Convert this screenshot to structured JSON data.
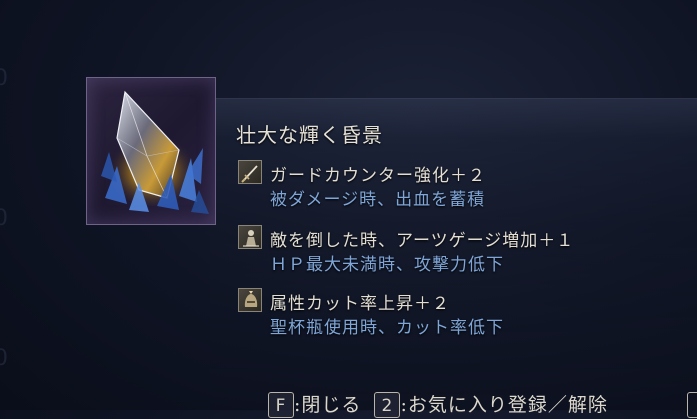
{
  "item": {
    "name": "壮大な輝く昏景",
    "icon": "crystal-shard-icon"
  },
  "effects": [
    {
      "icon": "sword-icon",
      "name": "ガードカウンター強化＋２",
      "desc": "被ダメージ時、出血を蓄積"
    },
    {
      "icon": "armor-figure-icon",
      "name": "敵を倒した時、アーツゲージ増加＋１",
      "desc": "ＨＰ最大未満時、攻撃力低下"
    },
    {
      "icon": "helmet-crest-icon",
      "name": "属性カット率上昇＋２",
      "desc": "聖杯瓶使用時、カット率低下"
    }
  ],
  "footer": {
    "close_key": "F",
    "close_label": ":閉じる",
    "fav_key": "2",
    "fav_label": ":お気に入り登録／解除"
  },
  "colors": {
    "effect_name": "#e2ded4",
    "effect_desc": "#7fa6d8",
    "frame_border": "#6f6488"
  }
}
